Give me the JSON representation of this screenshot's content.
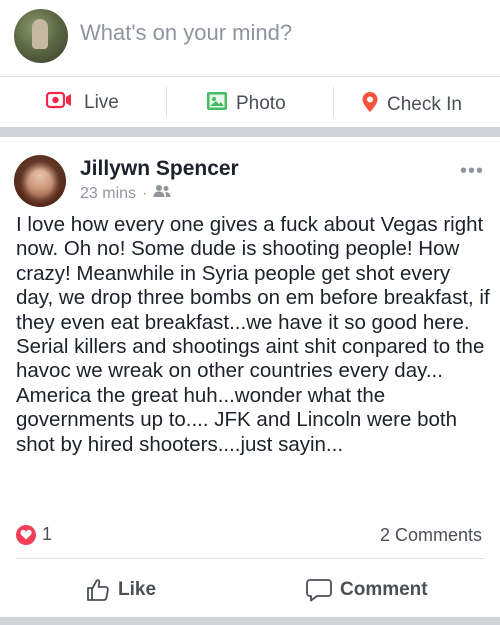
{
  "composer": {
    "placeholder": "What's on your mind?"
  },
  "actions": [
    {
      "label": "Live",
      "icon": "live-video-icon",
      "color": "#f02849"
    },
    {
      "label": "Photo",
      "icon": "photo-icon",
      "color": "#45bd62"
    },
    {
      "label": "Check In",
      "icon": "location-pin-icon",
      "color": "#f5533d"
    }
  ],
  "post": {
    "author": "Jillywn Spencer",
    "time": "23 mins",
    "separator": "·",
    "privacy_icon": "friends-icon",
    "more_icon": "more-options-icon",
    "text": "I love how every one gives a fuck about Vegas right now. Oh no! Some dude is shooting people! How crazy! Meanwhile in Syria people get shot every day, we drop three bombs on em before breakfast, if they even eat breakfast...we have it so good here. Serial killers and shootings aint shit conpared to the havoc we wreak on other countries every day... America the great huh...wonder what the governments up to.... JFK and Lincoln were both shot by hired shooters....just sayin...",
    "reaction_count": "1",
    "reaction_icon": "heart-reaction-icon",
    "comments": "2 Comments",
    "like_label": "Like",
    "comment_label": "Comment"
  },
  "colors": {
    "text": "#1d2129",
    "secondary": "#90949c",
    "divider": "#d1d3d8",
    "heart": "#f33e58"
  }
}
